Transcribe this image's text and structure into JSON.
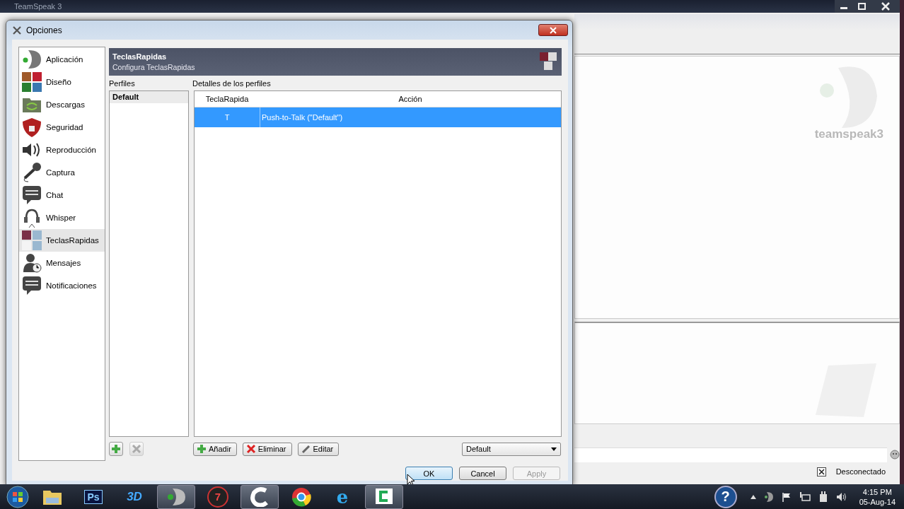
{
  "app_window": {
    "title": "TeamSpeak 3",
    "logo_text": "teamspeak3",
    "status": "Desconectado"
  },
  "dialog": {
    "title": "Opciones",
    "sidebar": [
      {
        "label": "Aplicación",
        "selected": false
      },
      {
        "label": "Diseño",
        "selected": false
      },
      {
        "label": "Descargas",
        "selected": false
      },
      {
        "label": "Seguridad",
        "selected": false
      },
      {
        "label": "Reproducción",
        "selected": false
      },
      {
        "label": "Captura",
        "selected": false
      },
      {
        "label": "Chat",
        "selected": false
      },
      {
        "label": "Whisper",
        "selected": false
      },
      {
        "label": "TeclasRapidas",
        "selected": true
      },
      {
        "label": "Mensajes",
        "selected": false
      },
      {
        "label": "Notificaciones",
        "selected": false
      }
    ],
    "header": {
      "title": "TeclasRapidas",
      "subtitle": "Configura TeclasRapidas"
    },
    "profiles": {
      "label": "Perfiles",
      "items": [
        {
          "label": "Default",
          "selected": true
        }
      ],
      "remove_disabled": true
    },
    "details": {
      "label": "Detalles de los perfiles",
      "columns": [
        "TeclaRapida",
        "Acción"
      ],
      "rows": [
        {
          "cells": [
            "T",
            "Push-to-Talk (\"Default\")"
          ],
          "selected": true
        }
      ]
    },
    "actions": [
      {
        "label": "Añadir",
        "kind": "add"
      },
      {
        "label": "Eliminar",
        "kind": "remove"
      },
      {
        "label": "Editar",
        "kind": "edit"
      }
    ],
    "profile_select": "Default",
    "buttons": [
      {
        "label": "OK",
        "focused": true,
        "disabled": false
      },
      {
        "label": "Cancel",
        "focused": false,
        "disabled": false
      },
      {
        "label": "Apply",
        "focused": false,
        "disabled": true
      }
    ]
  },
  "taskbar": {
    "apps": [
      {
        "kind": "folder",
        "active": false
      },
      {
        "kind": "photoshop",
        "label": "Ps",
        "active": false
      },
      {
        "kind": "threed",
        "label": "3D",
        "active": false
      },
      {
        "kind": "teamspeak",
        "active": true
      },
      {
        "kind": "target",
        "label": "7",
        "active": false
      },
      {
        "kind": "c-app",
        "active": true
      },
      {
        "kind": "chrome",
        "active": false
      },
      {
        "kind": "ie",
        "label": "e",
        "active": false
      },
      {
        "kind": "camtasia",
        "active": true
      }
    ],
    "help": "?",
    "time": "4:15 PM",
    "date": "05-Aug-14"
  }
}
